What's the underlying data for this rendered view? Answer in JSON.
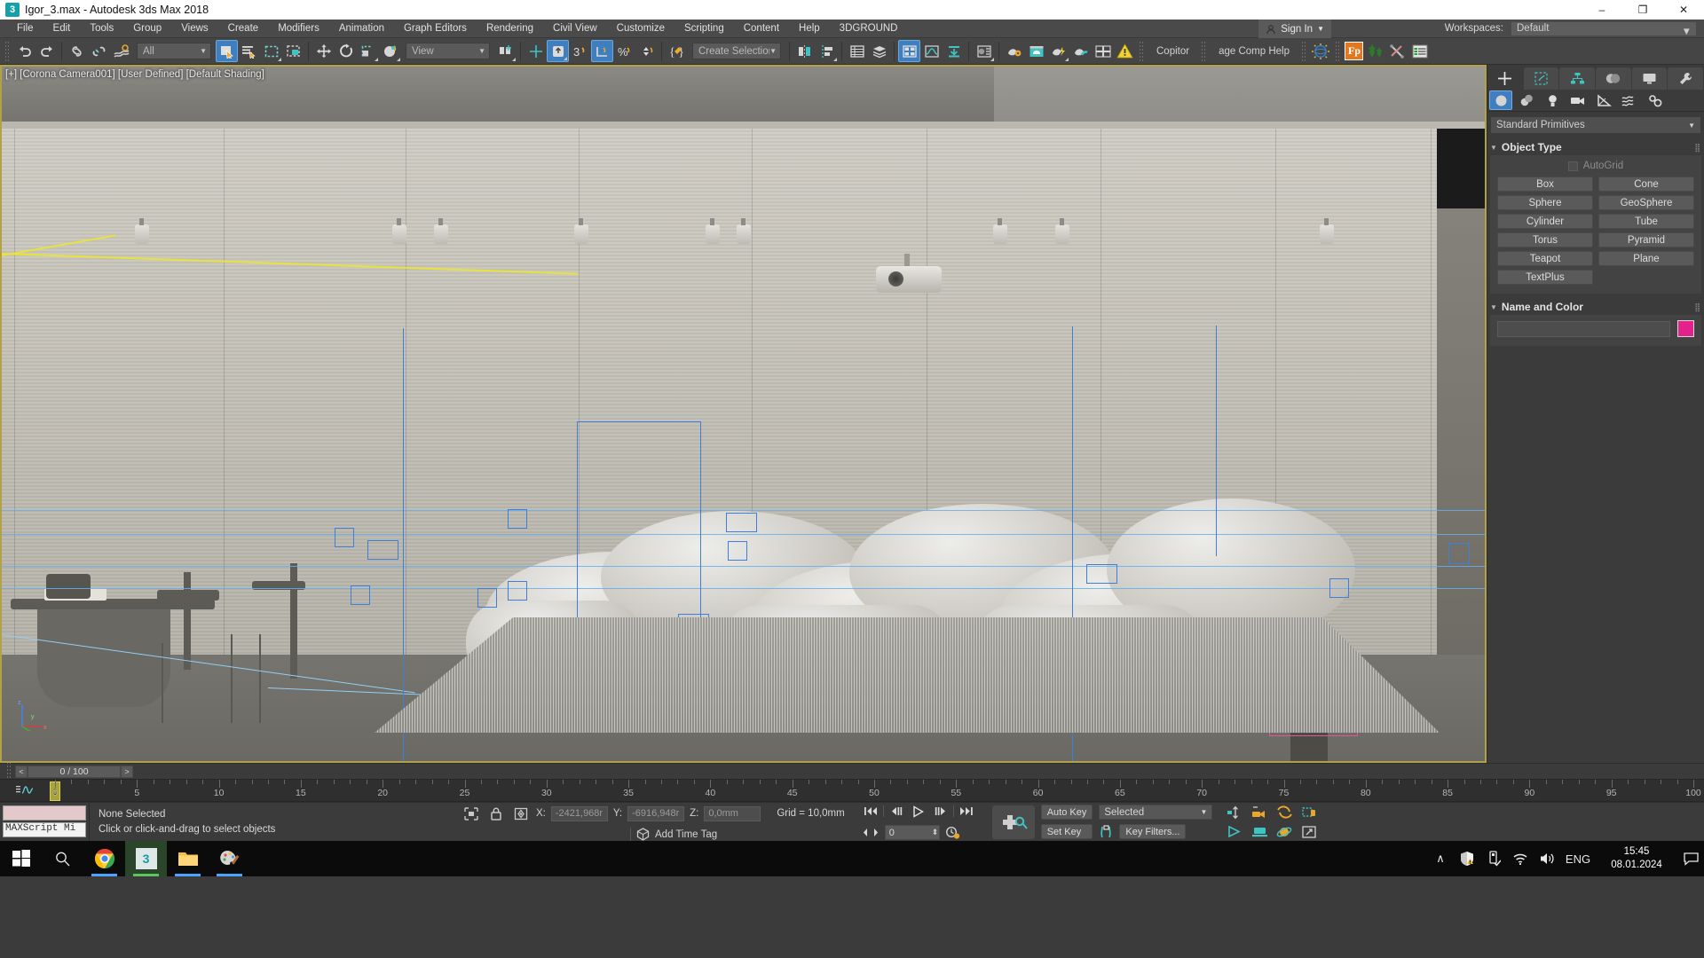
{
  "titlebar": {
    "app_icon": "3dsmax-icon",
    "title": "Igor_3.max - Autodesk 3ds Max 2018",
    "minimize": "–",
    "maximize": "❐",
    "close": "✕"
  },
  "menubar": {
    "items": [
      {
        "label": "File"
      },
      {
        "label": "Edit"
      },
      {
        "label": "Tools"
      },
      {
        "label": "Group"
      },
      {
        "label": "Views"
      },
      {
        "label": "Create"
      },
      {
        "label": "Modifiers"
      },
      {
        "label": "Animation"
      },
      {
        "label": "Graph Editors"
      },
      {
        "label": "Rendering"
      },
      {
        "label": "Civil View"
      },
      {
        "label": "Customize"
      },
      {
        "label": "Scripting"
      },
      {
        "label": "Content"
      },
      {
        "label": "Help"
      },
      {
        "label": "3DGROUND"
      }
    ],
    "sign_in": "Sign In",
    "workspaces_label": "Workspaces:",
    "workspace_value": "Default"
  },
  "toolbar": {
    "selection_filter": "All",
    "reference_coord": "View",
    "named_selection_sets": "Create Selection Se",
    "plugin_copitor": "Copitor",
    "plugin_comp_help": "age Comp Help",
    "icons": [
      "undo-icon",
      "redo-icon",
      "select-link-icon",
      "unlink-icon",
      "bind-spacewarp-icon",
      "select-object-icon",
      "select-by-name-icon",
      "rect-select-region-icon",
      "window-crossing-icon",
      "select-move-icon",
      "select-rotate-icon",
      "select-scale-icon",
      "placement-icon",
      "use-center-icon",
      "select-snap-toggle-icon",
      "angle-snap-icon",
      "percent-snap-icon",
      "spinner-snap-icon",
      "edit-named-selection-icon",
      "mirror-icon",
      "align-icon",
      "layer-explorer-icon",
      "scene-explorer-icon",
      "toggle-ribbon-icon",
      "curve-editor-icon",
      "schematic-view-icon",
      "material-editor-icon",
      "render-setup-icon",
      "render-frame-icon",
      "render-production-icon",
      "render-iterative-icon",
      "viewport-layout-icon",
      "warning-icon",
      "environment-icon",
      "forest-pack-icon",
      "railclone-icon",
      "tools-icon",
      "list-icon"
    ]
  },
  "viewport": {
    "label": "[+] [Corona Camera001] [User Defined] [Default Shading]",
    "axis_x": "x",
    "axis_y": "y",
    "axis_z": "z"
  },
  "command_panel": {
    "tabs": [
      {
        "name": "create-tab",
        "icon": "plus-icon",
        "active": true
      },
      {
        "name": "modify-tab",
        "icon": "modify-icon",
        "active": false
      },
      {
        "name": "hierarchy-tab",
        "icon": "hierarchy-icon",
        "active": false
      },
      {
        "name": "motion-tab",
        "icon": "motion-icon",
        "active": false
      },
      {
        "name": "display-tab",
        "icon": "display-icon",
        "active": false
      },
      {
        "name": "utilities-tab",
        "icon": "wrench-icon",
        "active": false
      }
    ],
    "sub_tabs": [
      {
        "name": "geometry-button",
        "icon": "sphere-icon",
        "active": true
      },
      {
        "name": "shapes-button",
        "icon": "shapes-icon",
        "active": false
      },
      {
        "name": "lights-button",
        "icon": "bulb-icon",
        "active": false
      },
      {
        "name": "cameras-button",
        "icon": "camera-icon",
        "active": false
      },
      {
        "name": "helpers-button",
        "icon": "tape-icon",
        "active": false
      },
      {
        "name": "spacewarps-button",
        "icon": "wave-icon",
        "active": false
      },
      {
        "name": "systems-button",
        "icon": "gears-icon",
        "active": false
      }
    ],
    "category": "Standard Primitives",
    "object_type": {
      "title": "Object Type",
      "autogrid_label": "AutoGrid",
      "buttons": [
        "Box",
        "Cone",
        "Sphere",
        "GeoSphere",
        "Cylinder",
        "Tube",
        "Torus",
        "Pyramid",
        "Teapot",
        "Plane",
        "TextPlus"
      ]
    },
    "name_and_color": {
      "title": "Name and Color",
      "name_value": "",
      "color": "#e2218a"
    }
  },
  "timeline": {
    "prev_label": "<",
    "next_label": ">",
    "frame_counter": "0 / 100",
    "current_frame": 0,
    "range_start": 0,
    "range_end": 100,
    "major_ticks": [
      0,
      5,
      10,
      15,
      20,
      25,
      30,
      35,
      40,
      45,
      50,
      55,
      60,
      65,
      70,
      75,
      80,
      85,
      90,
      95,
      100
    ],
    "slider_label": "0"
  },
  "status_bar": {
    "maxscript_placeholder": "MAXScript Mi",
    "selection_status": "None Selected",
    "prompt": "Click or click-and-drag to select objects",
    "coord_x_label": "X:",
    "coord_x_value": "-2421,968r",
    "coord_y_label": "Y:",
    "coord_y_value": "-6916,948r",
    "coord_z_label": "Z:",
    "coord_z_value": "0,0mm",
    "grid_label": "Grid = 10,0mm",
    "add_time_tag": "Add Time Tag",
    "auto_key": "Auto Key",
    "set_key": "Set Key",
    "key_mode": "Selected",
    "key_filters": "Key Filters...",
    "spinner_value": "0",
    "icons": [
      "isolate-selection-icon",
      "selection-lock-icon",
      "absolute-mode-icon",
      "time-tag-icon",
      "goto-start-icon",
      "prev-frame-icon",
      "play-icon",
      "next-frame-icon",
      "goto-end-icon",
      "key-mode-icon",
      "time-config-icon",
      "set-key-big-icon",
      "set-key-toggle-icon",
      "select-zoom-icon",
      "pan-view-icon",
      "orbit-icon",
      "maximize-viewport-icon",
      "field-of-view-icon",
      "zoom-extents-icon",
      "zoom-region-icon",
      "walkthrough-icon"
    ]
  },
  "taskbar": {
    "items": [
      {
        "name": "start-button",
        "icon": "windows-icon"
      },
      {
        "name": "search-button",
        "icon": "search-icon"
      },
      {
        "name": "chrome-button",
        "icon": "chrome-icon"
      },
      {
        "name": "3dsmax-button",
        "icon": "3dsmax-icon",
        "active": true
      },
      {
        "name": "explorer-button",
        "icon": "folder-icon"
      },
      {
        "name": "paint-button",
        "icon": "paint-icon"
      }
    ],
    "tray": {
      "chevron": "∧",
      "icons": [
        "defender-icon",
        "usb-icon",
        "wifi-icon",
        "volume-icon"
      ],
      "language": "ENG",
      "time": "15:45",
      "date": "08.01.2024",
      "action_center": "notification-icon"
    }
  }
}
